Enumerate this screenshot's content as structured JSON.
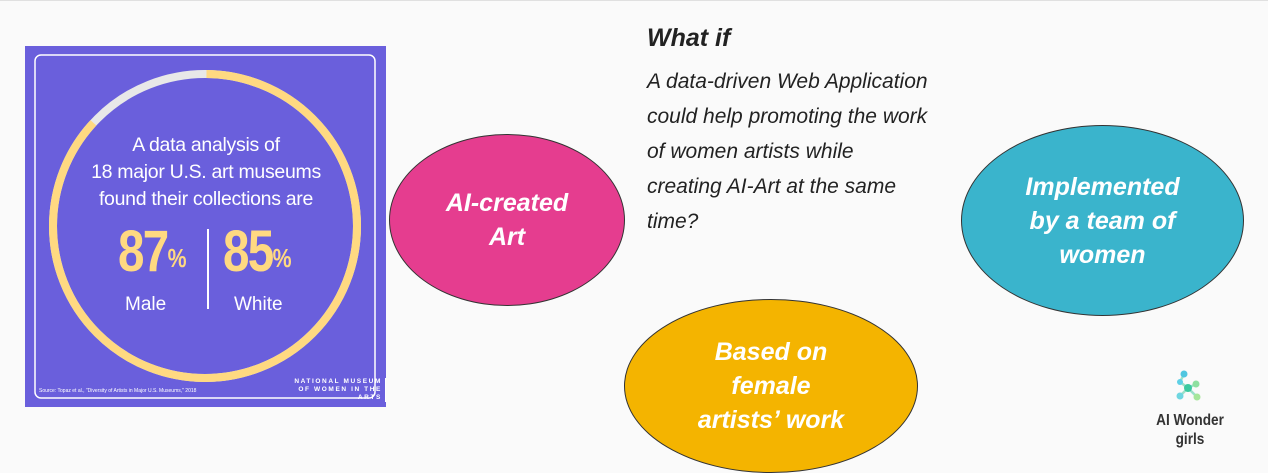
{
  "infographic": {
    "headline_lines": [
      "A data analysis of",
      "18 major U.S. art museums",
      "found their collections are"
    ],
    "stats": [
      {
        "value": "87",
        "unit": "%",
        "label": "Male"
      },
      {
        "value": "85",
        "unit": "%",
        "label": "White"
      }
    ],
    "ring_fraction": 0.87,
    "source": "Source: Topaz et al., \"Diversity of Artists in Major U.S. Museums,\" 2018",
    "publisher_lines": [
      "NATIONAL MUSEUM",
      "OF WOMEN IN THE ARTS"
    ],
    "colors": {
      "background": "#6a5fdc",
      "accent": "#ffd981",
      "ring_rest": "#e8e8e8"
    }
  },
  "ellipses": {
    "ai_art": {
      "lines": [
        "AI-created",
        "Art"
      ],
      "color": "#e53d8f"
    },
    "team": {
      "lines": [
        "Implemented",
        "by a team of",
        "women"
      ],
      "color": "#3ab4cc"
    },
    "female": {
      "lines": [
        "Based on",
        "female",
        "artists’ work"
      ],
      "color": "#f4b400"
    }
  },
  "question": {
    "title": "What if",
    "lines": [
      "A data-driven Web Application",
      "could help promoting the work",
      "of women artists while",
      "creating AI-Art at the same",
      "time?"
    ]
  },
  "logo": {
    "lines": [
      "AI Wonder",
      "girls"
    ],
    "icon": "molecule-network-icon"
  }
}
